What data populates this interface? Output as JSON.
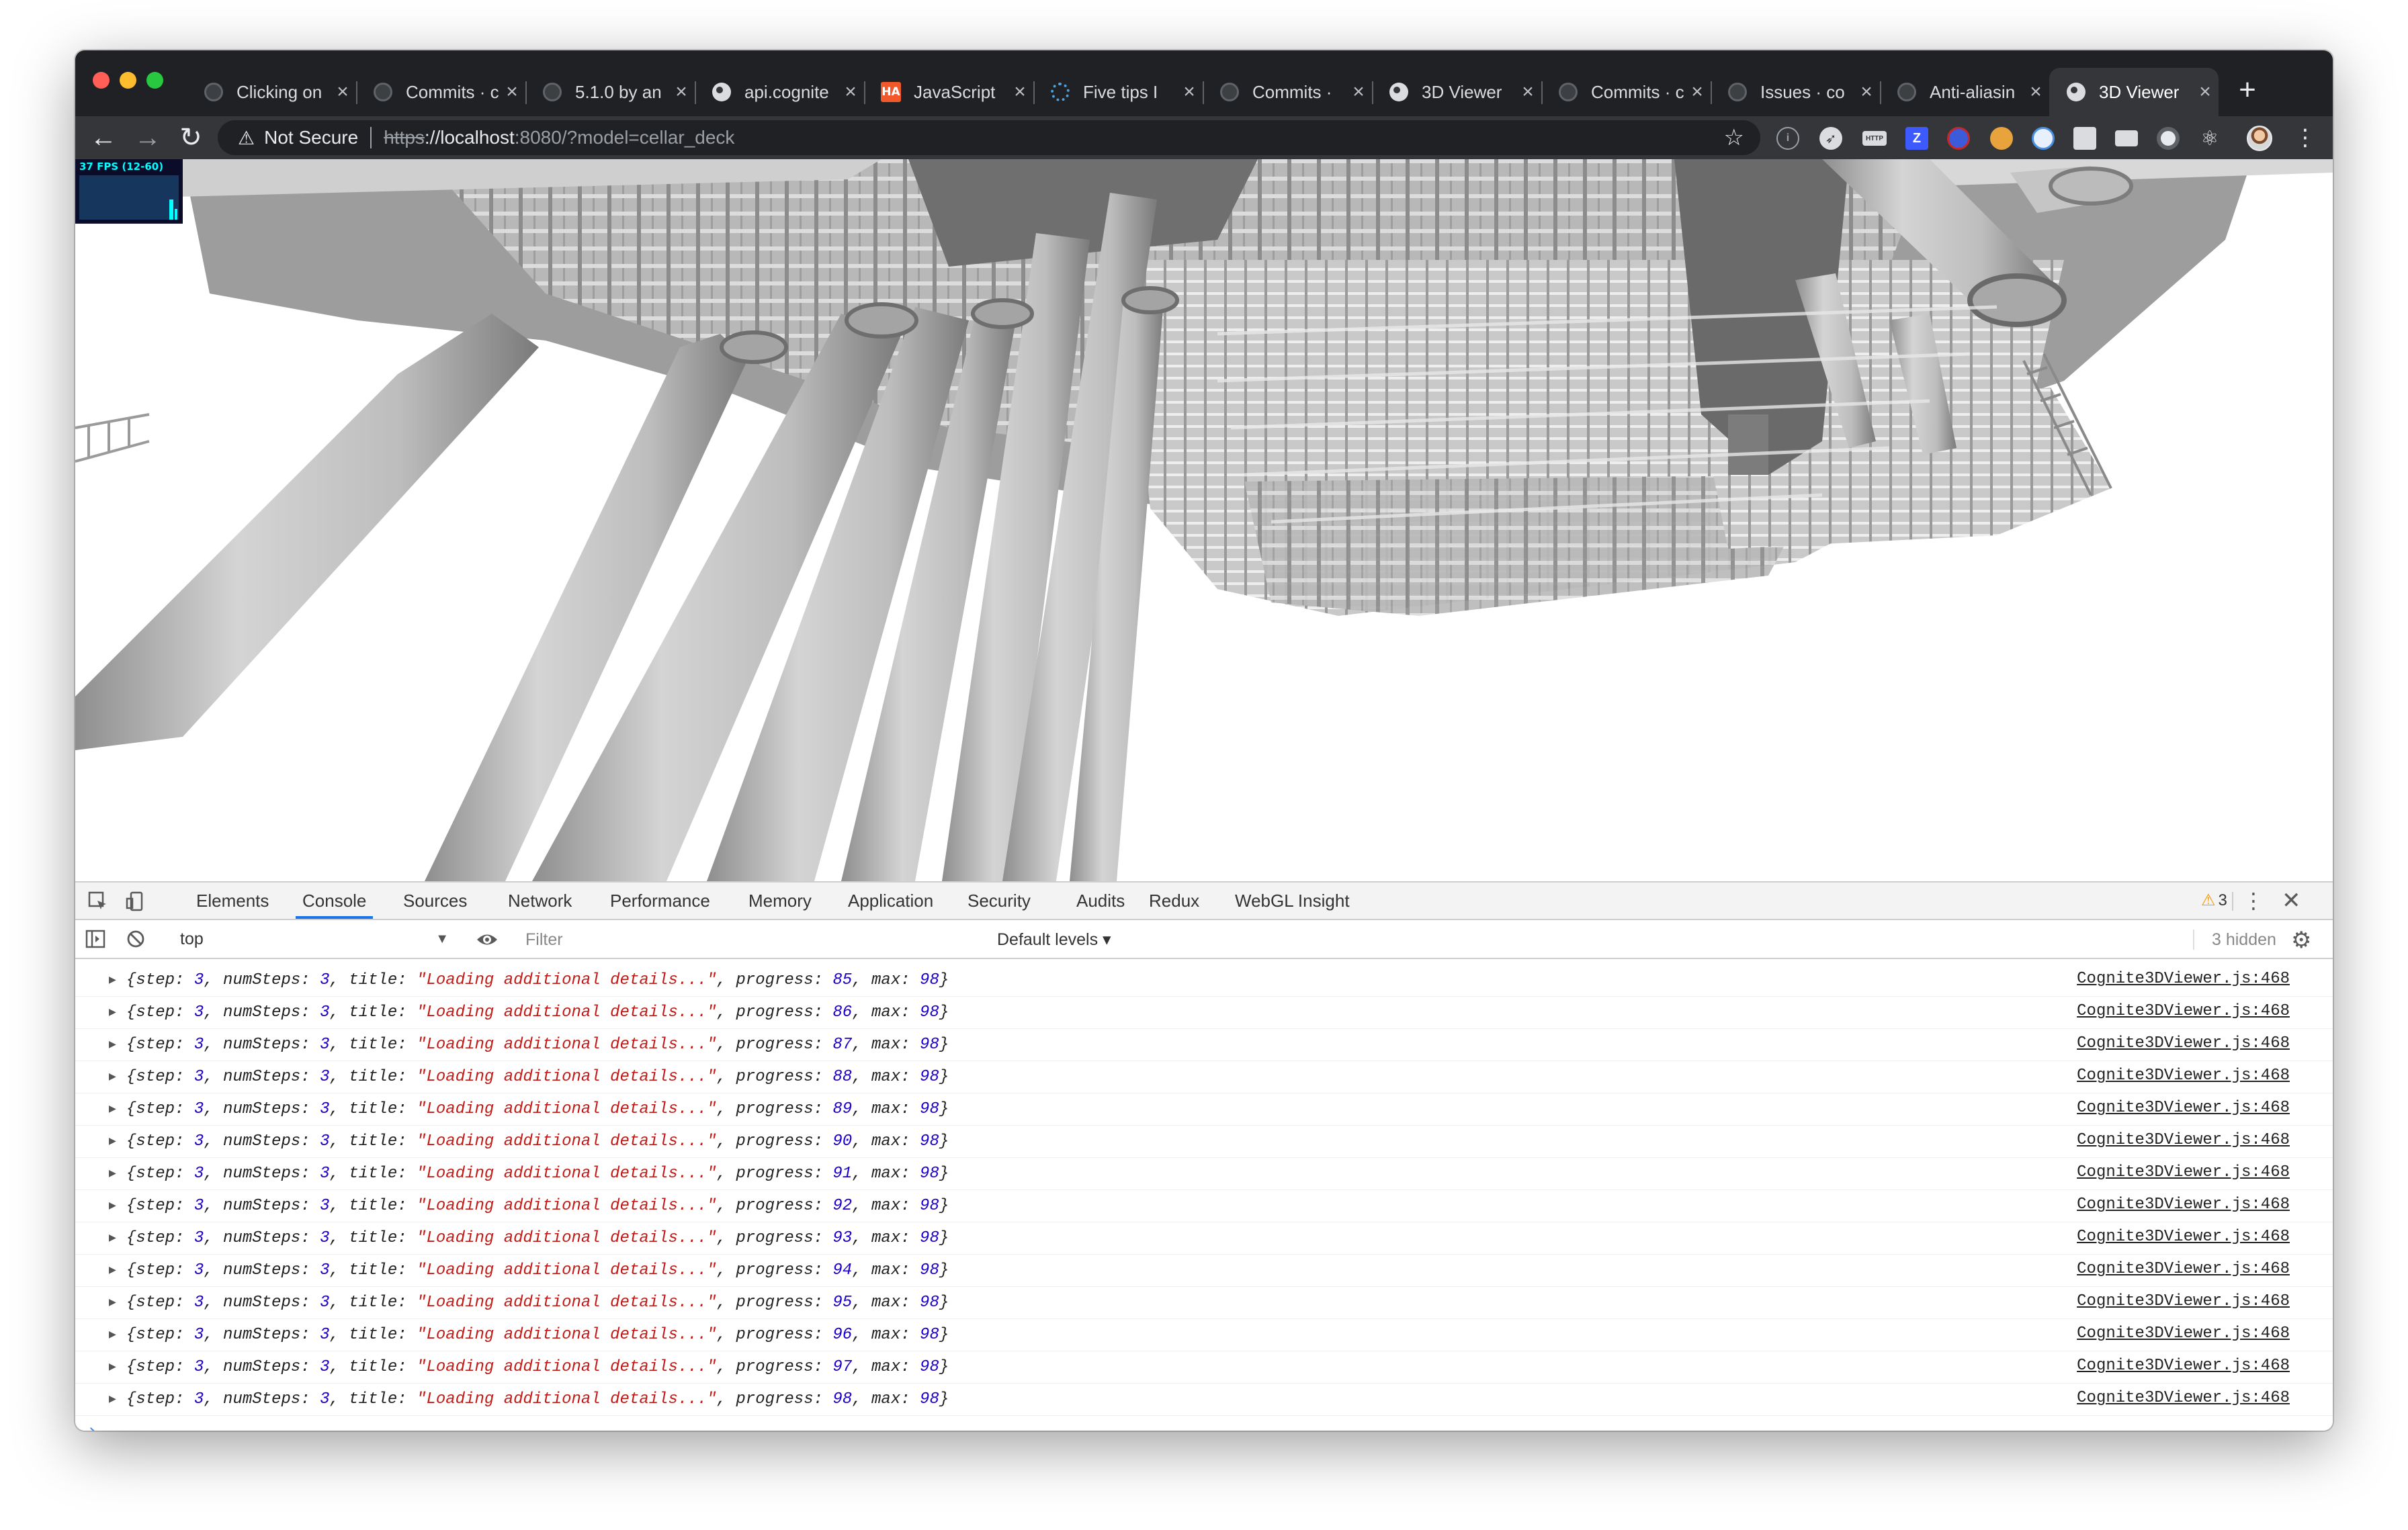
{
  "browser": {
    "tabs": [
      {
        "label": "Clicking on",
        "icon": "github-icon",
        "active": false
      },
      {
        "label": "Commits · c",
        "icon": "github-icon",
        "active": false
      },
      {
        "label": "5.1.0 by an",
        "icon": "github-icon",
        "active": false
      },
      {
        "label": "api.cognite",
        "icon": "globe-icon",
        "active": false
      },
      {
        "label": "JavaScript",
        "icon": "ha-icon",
        "active": false
      },
      {
        "label": "Five tips I",
        "icon": "spinner-icon",
        "active": false
      },
      {
        "label": "Commits ·",
        "icon": "github-icon",
        "active": false
      },
      {
        "label": "3D Viewer",
        "icon": "globe-icon",
        "active": false
      },
      {
        "label": "Commits · c",
        "icon": "github-icon",
        "active": false
      },
      {
        "label": "Issues · co",
        "icon": "github-icon",
        "active": false
      },
      {
        "label": "Anti-aliasin",
        "icon": "github-icon",
        "active": false
      },
      {
        "label": "3D Viewer",
        "icon": "globe-icon",
        "active": true
      }
    ],
    "new_tab_label": "+",
    "tab_close_label": "×",
    "security_label": "Not Secure",
    "url_scheme": "https",
    "url_host": "://localhost",
    "url_rest": ":8080/?model=cellar_deck"
  },
  "viewer": {
    "fps_label": "37 FPS (12-60)"
  },
  "devtools": {
    "tabs": [
      "Elements",
      "Console",
      "Sources",
      "Network",
      "Performance",
      "Memory",
      "Application",
      "Security",
      "Audits",
      "Redux",
      "WebGL Insight"
    ],
    "active_tab": "Console",
    "warning_count": "3",
    "context": "top",
    "filter_placeholder": "Filter",
    "levels_label": "Default levels ▾",
    "hidden_label": "3 hidden",
    "log_title": "\"Loading additional details...\"",
    "log_source": "Cognite3DViewer.js:468",
    "log_step": 3,
    "log_numSteps": 3,
    "log_max": 98,
    "log_progress": [
      85,
      86,
      87,
      88,
      89,
      90,
      91,
      92,
      93,
      94,
      95,
      96,
      97,
      98
    ],
    "prompt_symbol": "›"
  },
  "colors": {
    "tabstrip": "#202124",
    "toolbar": "#35363a",
    "accent": "#1a73e8",
    "console_number": "#1c00cf",
    "console_string": "#c41a16"
  }
}
